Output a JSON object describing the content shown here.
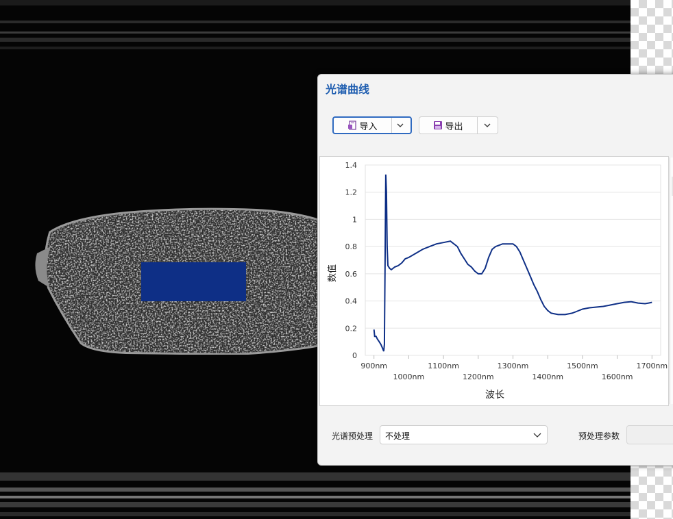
{
  "window": {
    "title": "光谱曲线"
  },
  "toolbar": {
    "import_label": "导入",
    "export_label": "导出"
  },
  "preprocess": {
    "label": "光谱预处理",
    "selected": "不处理",
    "param_label": "预处理参数",
    "param_value": ""
  },
  "colors": {
    "accent": "#2f6ac0",
    "title": "#1f5eb0",
    "roi": "#0e2f86",
    "line": "#0e2f86"
  },
  "chart_data": {
    "type": "line",
    "xlabel": "波长",
    "ylabel": "数值",
    "xlim": [
      875,
      1725
    ],
    "ylim": [
      0,
      1.4
    ],
    "grid": true,
    "yticks": [
      0,
      0.2,
      0.4,
      0.6,
      0.8,
      1,
      1.2,
      1.4
    ],
    "ytick_labels": [
      "0",
      "0.2",
      "0.4",
      "0.6",
      "0.8",
      "1",
      "1.2",
      "1.4"
    ],
    "xticks": [
      900,
      1000,
      1100,
      1200,
      1300,
      1400,
      1500,
      1600,
      1700
    ],
    "xtick_labels": [
      "900nm",
      "1000nm",
      "1100nm",
      "1200nm",
      "1300nm",
      "1400nm",
      "1500nm",
      "1600nm",
      "1700nm"
    ],
    "series": [
      {
        "x": [
          900,
          902,
          906,
          910,
          915,
          920,
          925,
          928,
          930,
          932,
          934,
          936,
          938,
          940,
          945,
          950,
          960,
          970,
          980,
          990,
          1000,
          1020,
          1040,
          1060,
          1080,
          1100,
          1120,
          1140,
          1150,
          1160,
          1170,
          1180,
          1190,
          1200,
          1210,
          1220,
          1230,
          1240,
          1250,
          1260,
          1270,
          1280,
          1290,
          1300,
          1310,
          1320,
          1330,
          1340,
          1350,
          1360,
          1370,
          1380,
          1390,
          1400,
          1410,
          1420,
          1430,
          1440,
          1450,
          1460,
          1470,
          1480,
          1490,
          1500,
          1520,
          1540,
          1560,
          1580,
          1600,
          1620,
          1640,
          1660,
          1680,
          1690,
          1700
        ],
        "y": [
          0.19,
          0.14,
          0.14,
          0.12,
          0.1,
          0.08,
          0.05,
          0.03,
          0.08,
          0.7,
          1.33,
          1.2,
          0.8,
          0.66,
          0.64,
          0.63,
          0.65,
          0.66,
          0.68,
          0.71,
          0.72,
          0.75,
          0.78,
          0.8,
          0.82,
          0.83,
          0.84,
          0.8,
          0.75,
          0.71,
          0.67,
          0.65,
          0.62,
          0.6,
          0.6,
          0.64,
          0.72,
          0.78,
          0.8,
          0.81,
          0.82,
          0.82,
          0.82,
          0.82,
          0.8,
          0.76,
          0.7,
          0.64,
          0.58,
          0.52,
          0.47,
          0.41,
          0.36,
          0.33,
          0.31,
          0.305,
          0.3,
          0.3,
          0.3,
          0.305,
          0.31,
          0.32,
          0.33,
          0.34,
          0.35,
          0.355,
          0.36,
          0.37,
          0.38,
          0.39,
          0.395,
          0.385,
          0.38,
          0.385,
          0.39
        ]
      }
    ]
  }
}
